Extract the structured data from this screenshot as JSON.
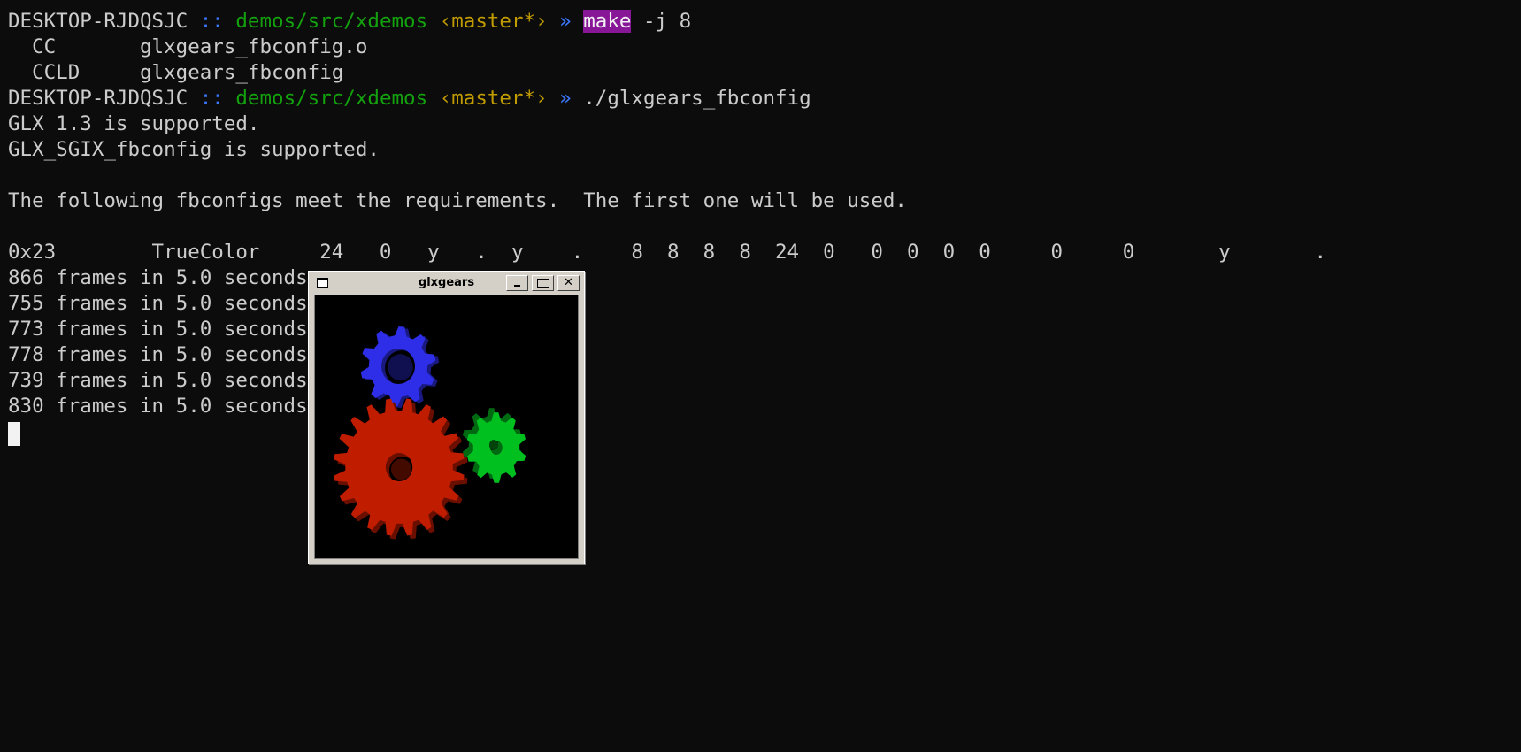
{
  "terminal": {
    "prompt1": {
      "host": "DESKTOP-RJDQSJC",
      "sep": "::",
      "path": "demos/src/xdemos",
      "branch": "‹master*›",
      "arrow": "»",
      "cmd": "make",
      "args": " -j 8"
    },
    "build_lines": [
      "  CC       glxgears_fbconfig.o",
      "  CCLD     glxgears_fbconfig"
    ],
    "prompt2": {
      "host": "DESKTOP-RJDQSJC",
      "sep": "::",
      "path": "demos/src/xdemos",
      "branch": "‹master*›",
      "arrow": "»",
      "cmd": "./glxgears_fbconfig"
    },
    "output_lines": [
      "GLX 1.3 is supported.",
      "GLX_SGIX_fbconfig is supported.",
      "",
      "The following fbconfigs meet the requirements.  The first one will be used.",
      "",
      "0x23        TrueColor     24   0   y   .  y    .    8  8  8  8  24  0   0  0  0  0     0     0       y       ."
    ],
    "frame_lines": [
      "866 frames in 5.0 seconds",
      "755 frames in 5.0 seconds",
      "773 frames in 5.0 seconds",
      "778 frames in 5.0 seconds",
      "739 frames in 5.0 seconds",
      "830 frames in 5.0 seconds"
    ]
  },
  "glxgears_window": {
    "title": "glxgears",
    "close_glyph": "✕",
    "gear_colors": {
      "red": "#c01c00",
      "green": "#00c020",
      "blue": "#2e2ee8"
    }
  },
  "colors": {
    "background": "#0c0c0c",
    "foreground": "#cccccc",
    "path": "#13a10e",
    "branch": "#c19c00",
    "prompt": "#3b78ff",
    "highlight": "#881798"
  }
}
